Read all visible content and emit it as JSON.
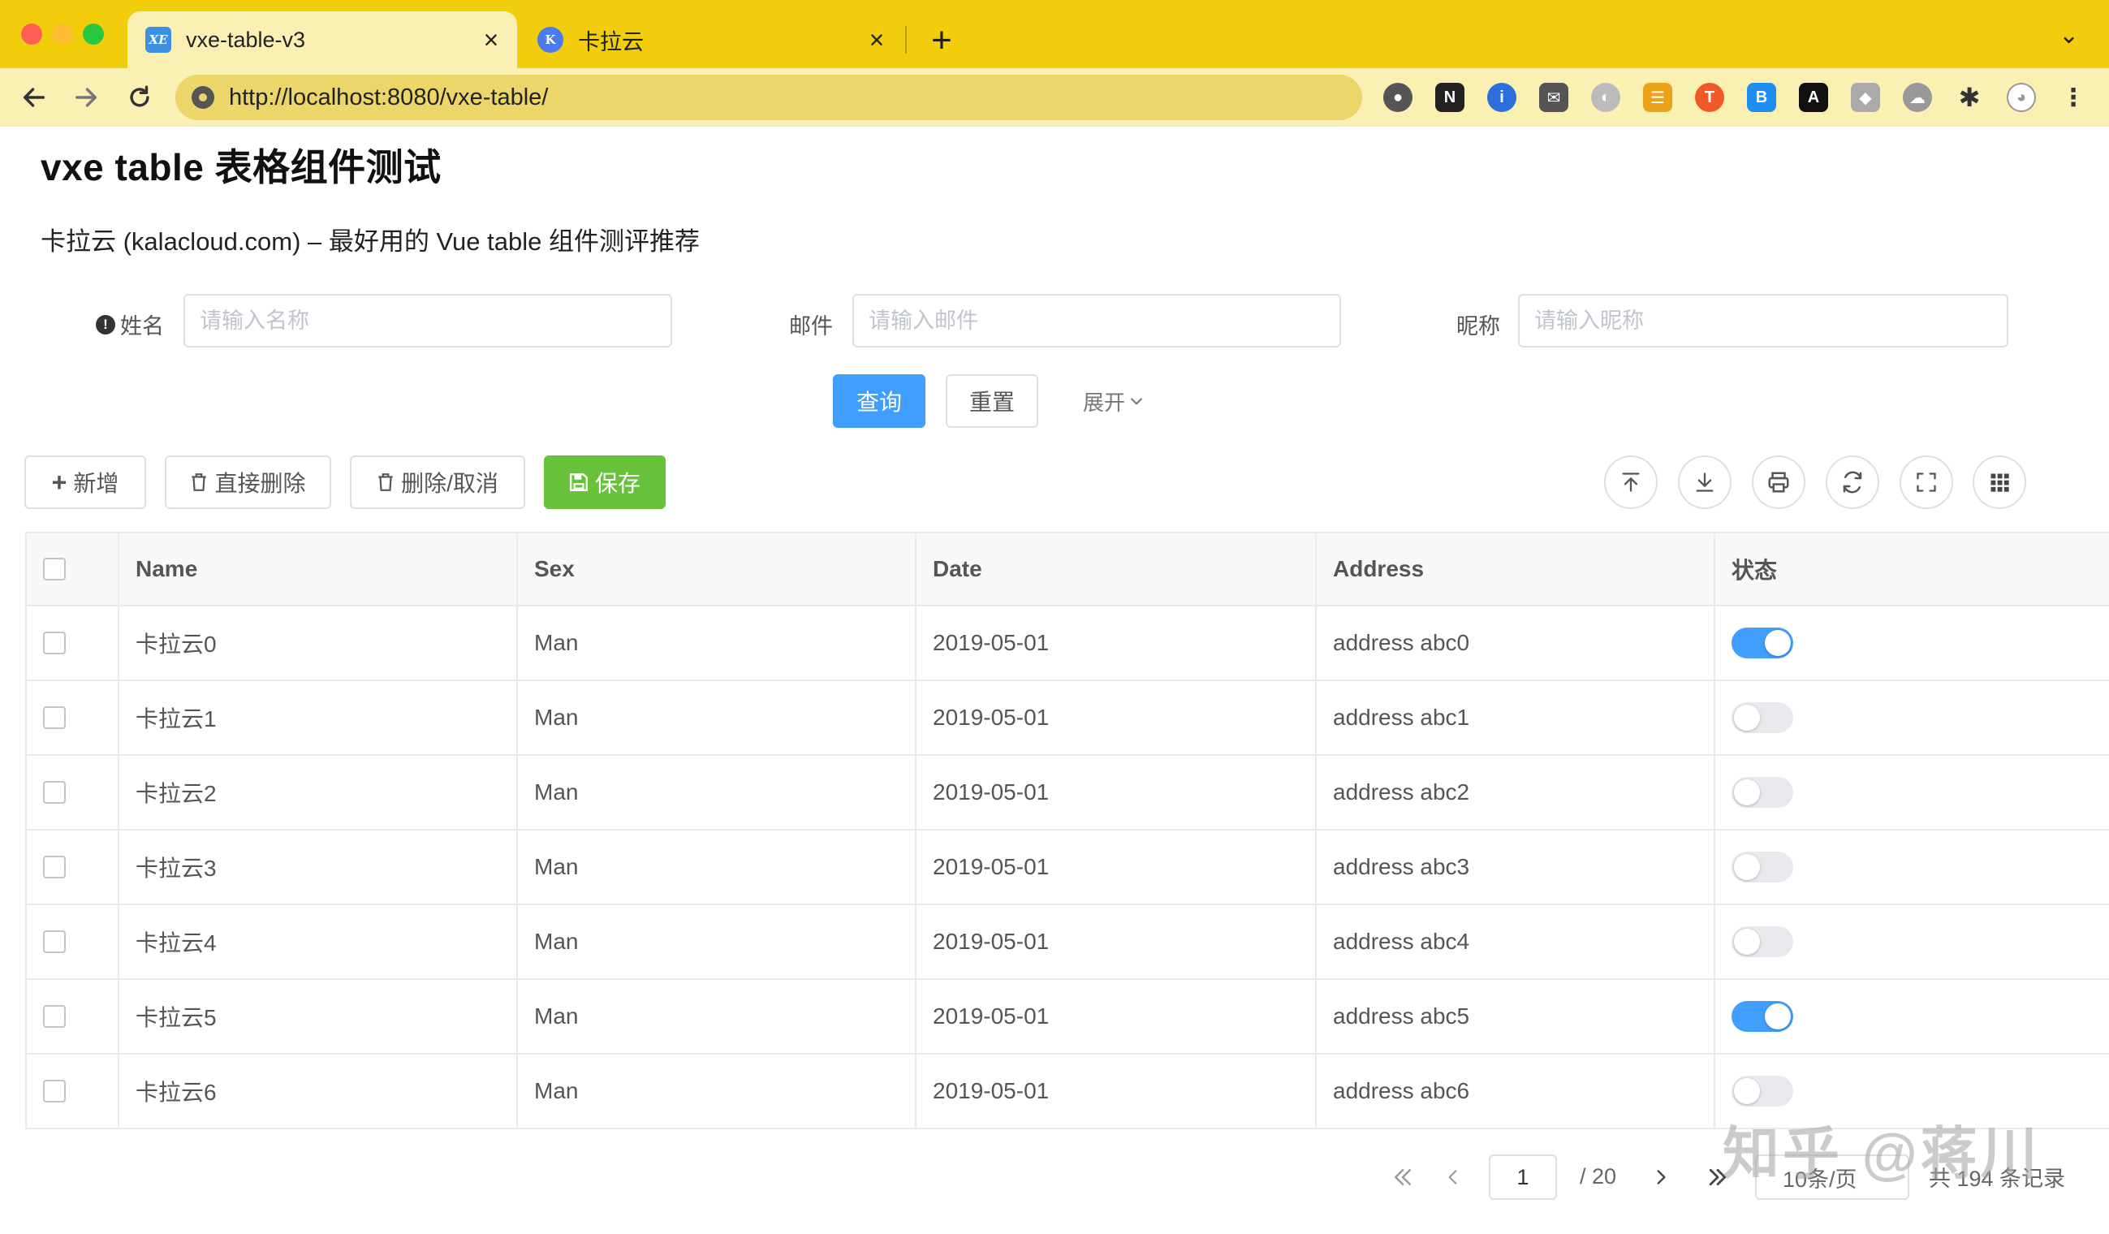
{
  "browser": {
    "tabs": [
      {
        "title": "vxe-table-v3",
        "favicon": "vxe-favicon-icon",
        "active": true
      },
      {
        "title": "卡拉云",
        "favicon": "kalacloud-favicon-icon",
        "active": false
      }
    ],
    "url": "http://localhost:8080/vxe-table/",
    "extensions": [
      "tomato-icon",
      "notion-icon",
      "password-icon",
      "mail-icon",
      "moon-icon",
      "grid-icon",
      "translate-icon",
      "bookmark-icon",
      "note-icon",
      "shield-icon",
      "cloud-icon",
      "puzzle-icon",
      "avatar-icon"
    ]
  },
  "page": {
    "title": "vxe table 表格组件测试",
    "subtitle": "卡拉云 (kalacloud.com) – 最好用的 Vue table 组件测评推荐"
  },
  "form": {
    "fields": [
      {
        "label": "姓名",
        "placeholder": "请输入名称",
        "value": "",
        "has_info_icon": true
      },
      {
        "label": "邮件",
        "placeholder": "请输入邮件",
        "value": ""
      },
      {
        "label": "昵称",
        "placeholder": "请输入昵称",
        "value": ""
      }
    ],
    "query_label": "查询",
    "reset_label": "重置",
    "expand_label": "展开"
  },
  "toolbar": {
    "add_label": "新增",
    "delete_label": "直接删除",
    "mark_delete_label": "删除/取消",
    "save_label": "保存",
    "tools": [
      "import-icon",
      "export-icon",
      "print-icon",
      "refresh-icon",
      "fullscreen-icon",
      "columns-icon"
    ]
  },
  "table": {
    "columns": [
      "Name",
      "Sex",
      "Date",
      "Address",
      "状态"
    ],
    "rows": [
      {
        "name": "卡拉云0",
        "sex": "Man",
        "date": "2019-05-01",
        "address": "address abc0",
        "status": true
      },
      {
        "name": "卡拉云1",
        "sex": "Man",
        "date": "2019-05-01",
        "address": "address abc1",
        "status": false
      },
      {
        "name": "卡拉云2",
        "sex": "Man",
        "date": "2019-05-01",
        "address": "address abc2",
        "status": false
      },
      {
        "name": "卡拉云3",
        "sex": "Man",
        "date": "2019-05-01",
        "address": "address abc3",
        "status": false
      },
      {
        "name": "卡拉云4",
        "sex": "Man",
        "date": "2019-05-01",
        "address": "address abc4",
        "status": false
      },
      {
        "name": "卡拉云5",
        "sex": "Man",
        "date": "2019-05-01",
        "address": "address abc5",
        "status": true
      },
      {
        "name": "卡拉云6",
        "sex": "Man",
        "date": "2019-05-01",
        "address": "address abc6",
        "status": false
      }
    ]
  },
  "pager": {
    "current_page": "1",
    "total_pages": "/ 20",
    "page_size": "10条/页",
    "total": "共 194 条记录"
  },
  "watermark": "知乎 @蒋川",
  "colors": {
    "chrome_yellow": "#f1cd0b",
    "primary": "#409eff",
    "success": "#67c23a"
  }
}
